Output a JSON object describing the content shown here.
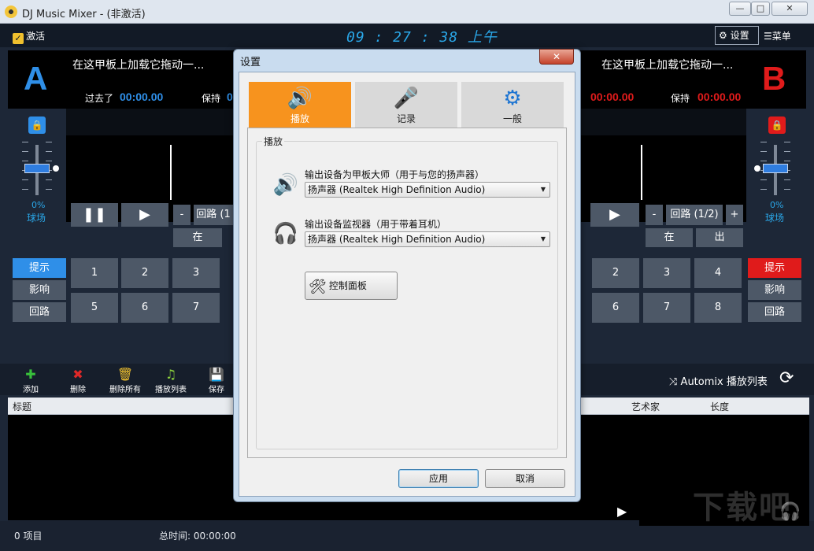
{
  "window": {
    "title": "DJ Music Mixer - (非激活)",
    "minimize": "—",
    "maximize": "□",
    "close": "✕"
  },
  "topbar": {
    "activate_label": "激活",
    "clock": "09 : 27 : 38 上午",
    "settings_label": "设置",
    "menu_label": "菜单"
  },
  "deck_a": {
    "letter": "A",
    "track": "在这甲板上加载它拖动一...",
    "elapsed_label": "过去了",
    "elapsed": "00:00.00",
    "remain_label": "保持",
    "remain_partial": "0",
    "pct": "0%",
    "bpm_label": "球场",
    "loop_label": "回路 (1",
    "in_label": "在",
    "minus": "-"
  },
  "deck_b": {
    "letter": "B",
    "track": "在这甲板上加载它拖动一...",
    "elapsed": "00:00.00",
    "remain_label": "保持",
    "remain": "00:00.00",
    "pct": "0%",
    "bpm_label": "球场",
    "loop_label": "回路 (1/2)",
    "in_label": "在",
    "out_label": "出",
    "minus": "-",
    "plus": "+"
  },
  "side_buttons": {
    "cue": "提示",
    "effect": "影响",
    "loop": "回路"
  },
  "hotkeys_a": [
    "1",
    "2",
    "3",
    "5",
    "6",
    "7"
  ],
  "hotkeys_b": [
    "2",
    "3",
    "4",
    "6",
    "7",
    "8"
  ],
  "toolbar": {
    "add": "添加",
    "delete": "删除",
    "delete_all": "删除所有",
    "playlist": "播放列表",
    "save": "保存",
    "automix": "Automix 播放列表"
  },
  "playlist": {
    "col_title": "标题",
    "col_artist": "艺术家",
    "col_length": "长度"
  },
  "status": {
    "items": "0 项目",
    "total_time": "总时间: 00:00:00"
  },
  "dialog": {
    "title": "设置",
    "tabs": [
      {
        "label": "播放",
        "icon": "speaker-icon"
      },
      {
        "label": "记录",
        "icon": "microphone-icon"
      },
      {
        "label": "一般",
        "icon": "gears-icon"
      }
    ],
    "group_label": "播放",
    "master_label": "输出设备为甲板大师（用于与您的扬声器）",
    "master_value": "扬声器 (Realtek High Definition Audio)",
    "monitor_label": "输出设备监视器（用于带着耳机）",
    "monitor_value": "扬声器 (Realtek High Definition Audio)",
    "control_panel": "控制面板",
    "apply": "应用",
    "cancel": "取消"
  },
  "watermark": "下载吧",
  "colors": {
    "deck_a": "#2f8fe8",
    "deck_b": "#e01b1b",
    "accent_tab": "#f7931e",
    "icon_blue": "#1c74d2"
  }
}
